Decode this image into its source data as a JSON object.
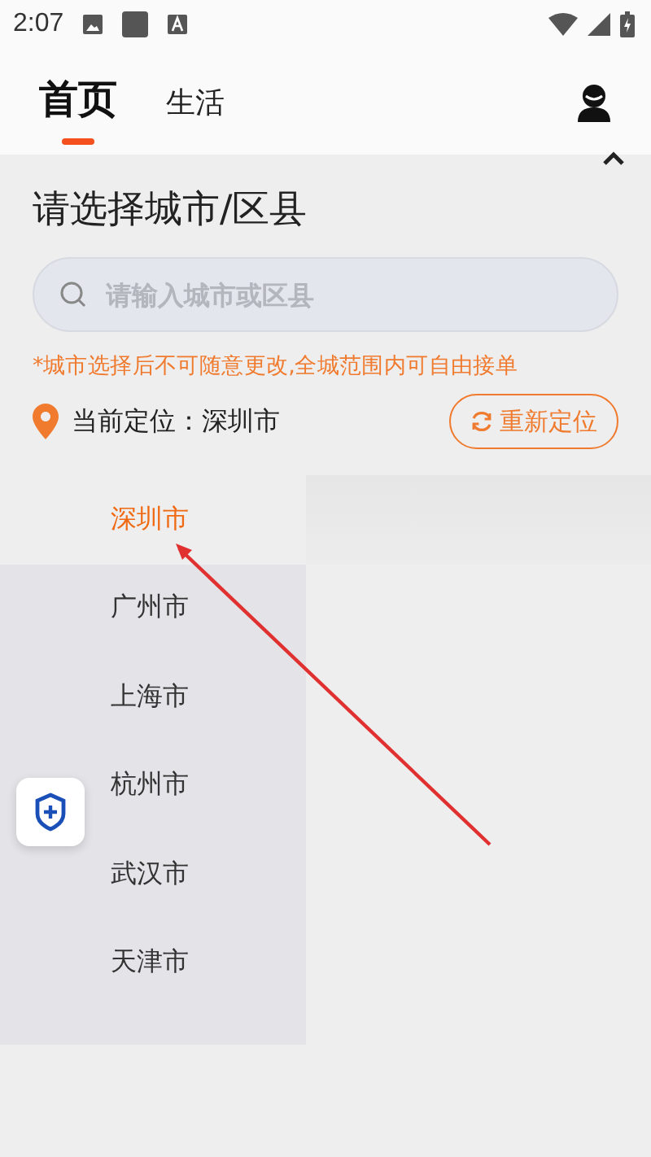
{
  "status_bar": {
    "time": "2:07"
  },
  "tabs": [
    {
      "label": "首页",
      "selected": true
    },
    {
      "label": "生活",
      "selected": false
    }
  ],
  "panel": {
    "title": "请选择城市/区县",
    "search": {
      "placeholder": "请输入城市或区县"
    },
    "notice": "*城市选择后不可随意更改,全城范围内可自由接单",
    "location": {
      "label": "当前定位：深圳市",
      "button": "重新定位"
    }
  },
  "cities": [
    {
      "name": "深圳市",
      "selected": true
    },
    {
      "name": "广州市",
      "selected": false
    },
    {
      "name": "上海市",
      "selected": false
    },
    {
      "name": "杭州市",
      "selected": false
    },
    {
      "name": "武汉市",
      "selected": false
    },
    {
      "name": "天津市",
      "selected": false
    }
  ]
}
